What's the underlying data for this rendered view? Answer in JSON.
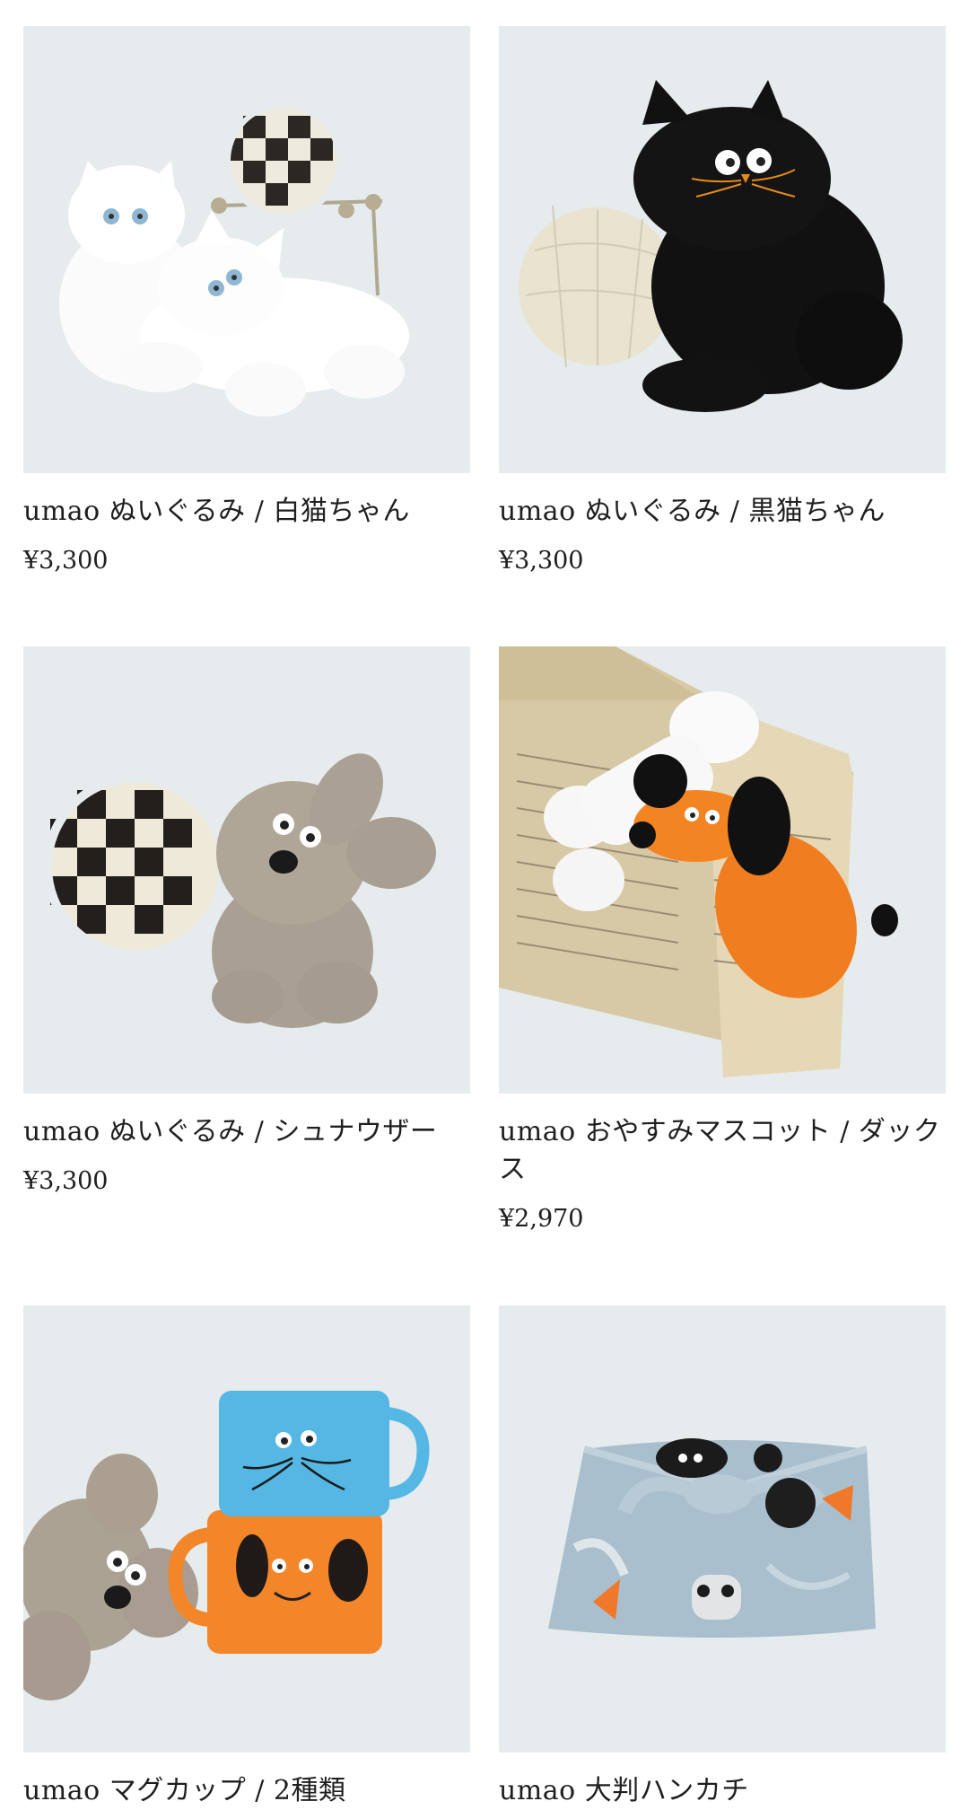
{
  "products": [
    {
      "title": "umao ぬいぐるみ / 白猫ちゃん",
      "price": "¥3,300",
      "image_icon": "white-cat-plush-image"
    },
    {
      "title": "umao ぬいぐるみ / 黒猫ちゃん",
      "price": "¥3,300",
      "image_icon": "black-cat-plush-image"
    },
    {
      "title": "umao ぬいぐるみ / シュナウザー",
      "price": "¥3,300",
      "image_icon": "schnauzer-plush-image"
    },
    {
      "title": "umao おやすみマスコット / ダックス",
      "price": "¥2,970",
      "image_icon": "dachshund-mascot-image"
    },
    {
      "title": "umao マグカップ / 2種類",
      "price": "",
      "image_icon": "mug-cups-image"
    },
    {
      "title": "umao 大判ハンカチ",
      "price": "",
      "image_icon": "large-handkerchief-image"
    }
  ],
  "colors": {
    "image_bg": "#e6ebee",
    "text": "#1f1f1f",
    "page_bg": "#ffffff"
  }
}
